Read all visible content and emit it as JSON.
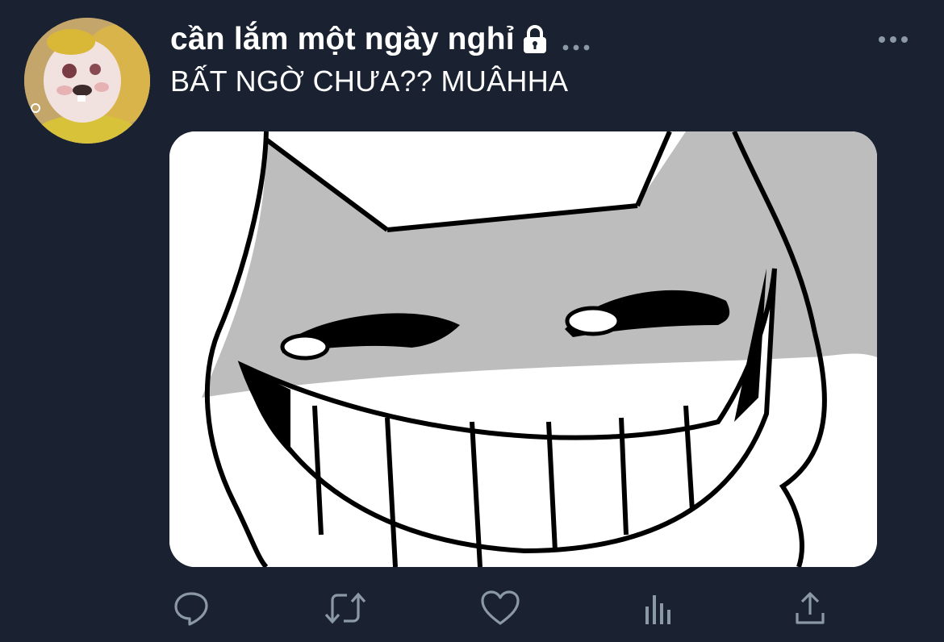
{
  "tweet": {
    "display_name": "cần lắm một ngày nghỉ",
    "text": "BẤT NGỜ CHƯA?? MUÂHHA",
    "protected_icon": "lock-icon",
    "media_alt": "cartoon-cat-grin"
  },
  "icons": {
    "reply": "reply-icon",
    "retweet": "retweet-icon",
    "like": "heart-icon",
    "analytics": "analytics-icon",
    "share": "share-icon",
    "more": "more-icon"
  },
  "colors": {
    "background": "#1a2130",
    "text": "#ffffff",
    "icon": "#8b98a5"
  }
}
